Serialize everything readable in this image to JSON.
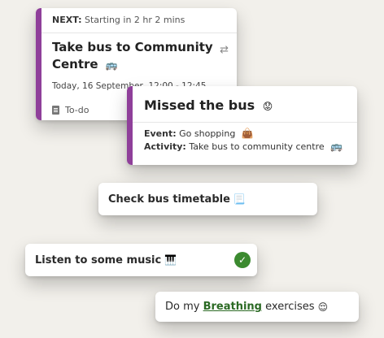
{
  "next_event": {
    "next_label": "NEXT:",
    "next_time": "Starting in 2 hr 2 mins",
    "title": "Take bus to Community Centre",
    "title_emoji": "🚌",
    "datetime": "Today, 16 September, 12:00 - 12:45",
    "status": "To-do",
    "accent_color": "#8f3f9a",
    "icons": [
      "repeat-icon",
      "clipboard-icon"
    ]
  },
  "missed": {
    "title": "Missed the bus",
    "title_emoji": "😟",
    "event_label": "Event:",
    "event_value": "Go shopping",
    "event_emoji": "👜",
    "activity_label": "Activity:",
    "activity_value": "Take bus to community centre",
    "activity_emoji": "🚌"
  },
  "tasks": [
    {
      "label": "Check bus timetable",
      "emoji": "📃"
    },
    {
      "label": "Listen to some music",
      "emoji": "🎹",
      "completed": true
    },
    {
      "prefix": "Do my ",
      "link": "Breathing",
      "suffix": " exercises",
      "emoji": "😌"
    }
  ]
}
